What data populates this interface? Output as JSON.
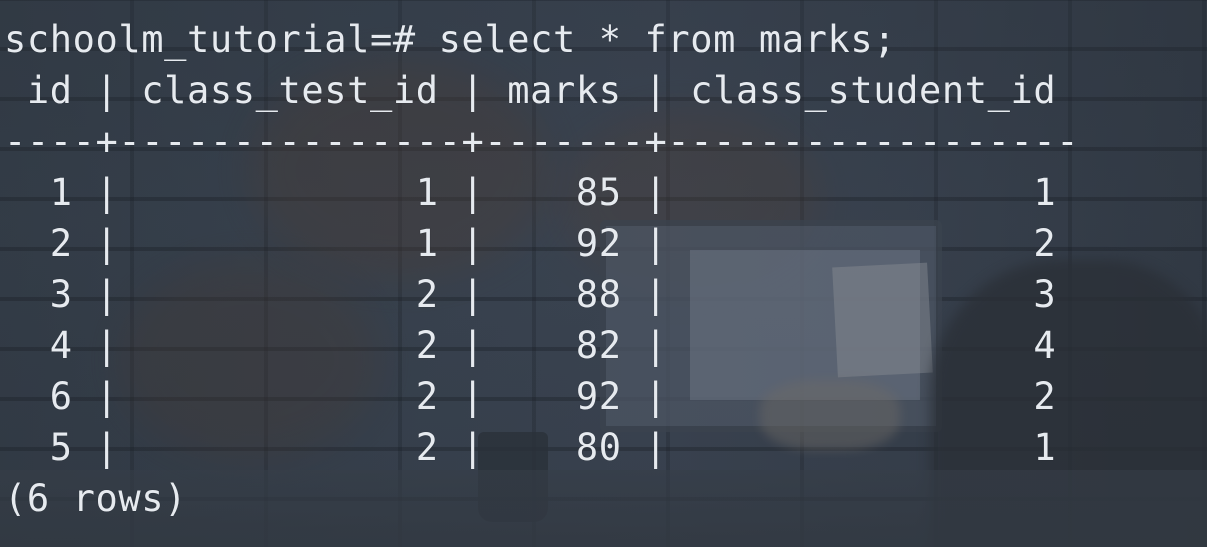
{
  "terminal": {
    "prompt_line": "schoolm_tutorial=# select * from marks;",
    "header_line": " id | class_test_id | marks | class_student_id",
    "separator_line": "----+---------------+-------+------------------",
    "rows": [
      "  1 |             1 |    85 |                1",
      "  2 |             1 |    92 |                2",
      "  3 |             2 |    88 |                3",
      "  4 |             2 |    82 |                4",
      "  6 |             2 |    92 |                2",
      "  5 |             2 |    80 |                1"
    ],
    "footer_line": "(6 rows)"
  },
  "table": {
    "columns": [
      "id",
      "class_test_id",
      "marks",
      "class_student_id"
    ],
    "values": [
      [
        1,
        1,
        85,
        1
      ],
      [
        2,
        1,
        92,
        2
      ],
      [
        3,
        2,
        88,
        3
      ],
      [
        4,
        2,
        82,
        4
      ],
      [
        6,
        2,
        92,
        2
      ],
      [
        5,
        2,
        80,
        1
      ]
    ]
  },
  "colors": {
    "text": "#e6eaef",
    "background": "#2f3741"
  }
}
